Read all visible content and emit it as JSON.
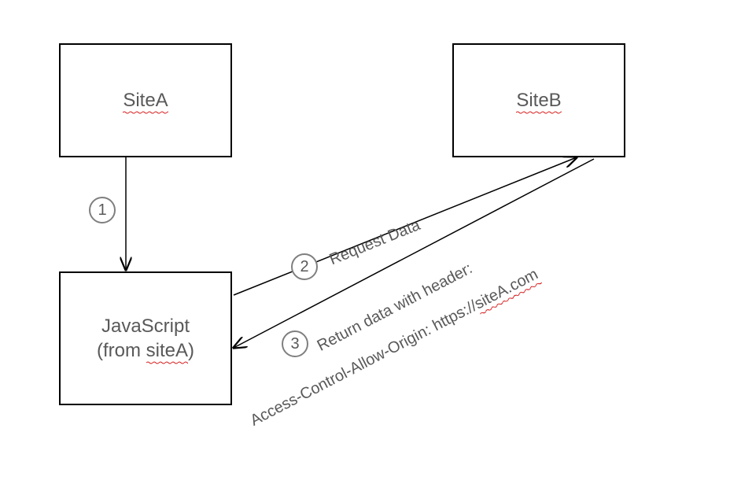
{
  "boxes": {
    "siteA": {
      "label": "SiteA"
    },
    "siteB": {
      "label": "SiteB"
    },
    "js": {
      "line1": "JavaScript",
      "line2_pre": "(from ",
      "line2_sq": "siteA",
      "line2_post": ")"
    }
  },
  "steps": {
    "s1": "1",
    "s2": "2",
    "s3": "3"
  },
  "labels": {
    "request": "Request Data",
    "return_l1": "Return data with header:",
    "return_l2_pre": "Access-Control-Allow-Origin: https://",
    "return_l2_sq": "siteA.com"
  }
}
